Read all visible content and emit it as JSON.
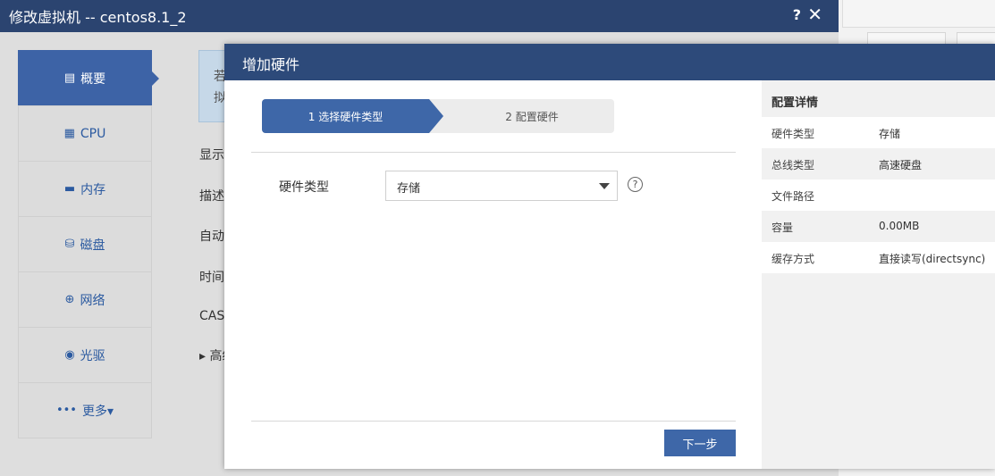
{
  "outer": {
    "title": "修改虚拟机 -- centos8.1_2",
    "help": "?",
    "close": "✕",
    "sidebar": [
      {
        "label": "概要",
        "icon": "summary-icon",
        "glyph": "▤"
      },
      {
        "label": "CPU",
        "icon": "cpu-icon",
        "glyph": "▦"
      },
      {
        "label": "内存",
        "icon": "memory-icon",
        "glyph": "▬"
      },
      {
        "label": "磁盘",
        "icon": "disk-icon",
        "glyph": "⛁"
      },
      {
        "label": "网络",
        "icon": "network-icon",
        "glyph": "⊕"
      },
      {
        "label": "光驱",
        "icon": "cdrom-icon",
        "glyph": "◉"
      },
      {
        "label": "更多▾",
        "icon": "more-icon",
        "glyph": "•••"
      }
    ],
    "info_fragments": [
      "若",
      "拟"
    ],
    "label_fragments": [
      "显示",
      "描述",
      "自动",
      "时间",
      "CAS",
      "▸ 高级"
    ]
  },
  "modal": {
    "title": "增加硬件",
    "steps": [
      "1 选择硬件类型",
      "2 配置硬件"
    ],
    "field_label": "硬件类型",
    "select_value": "存储",
    "help_glyph": "?",
    "next_label": "下一步"
  },
  "details": {
    "heading": "配置详情",
    "rows": [
      {
        "key": "硬件类型",
        "value": "存储"
      },
      {
        "key": "总线类型",
        "value": "高速硬盘"
      },
      {
        "key": "文件路径",
        "value": ""
      },
      {
        "key": "容量",
        "value": "0.00MB"
      },
      {
        "key": "缓存方式",
        "value": "直接读写(directsync)"
      }
    ]
  },
  "colors": {
    "title_bar": "#2b4470",
    "accent": "#3e67a8",
    "sidebar_bg": "#dcdcdc"
  }
}
